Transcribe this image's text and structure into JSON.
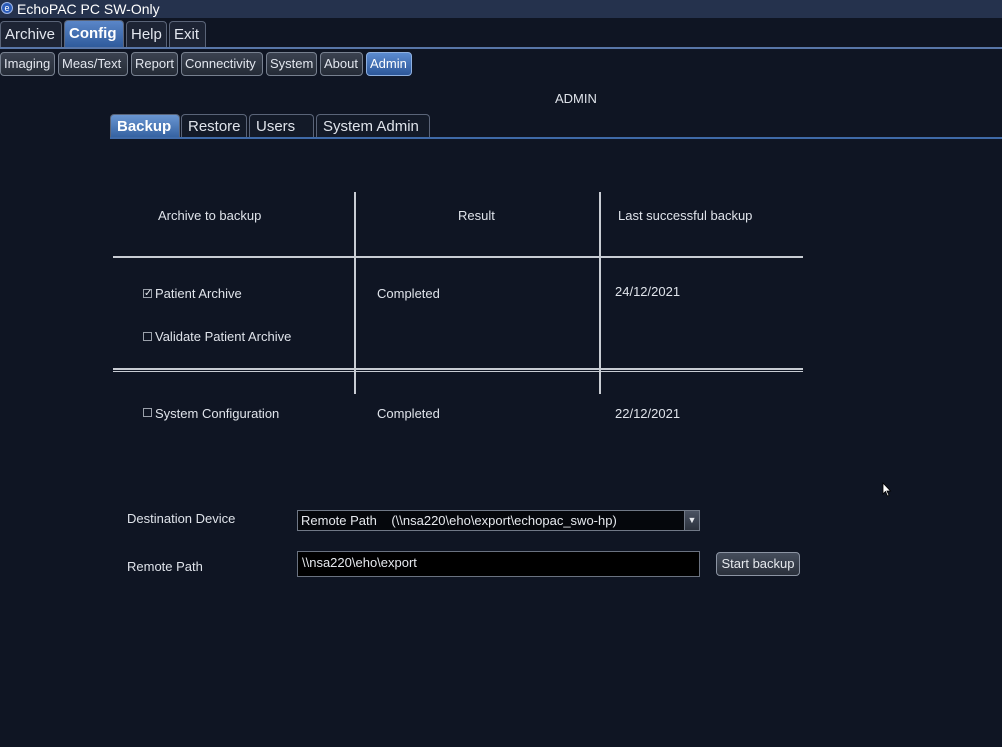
{
  "window": {
    "title": "EchoPAC PC SW-Only",
    "icon": "app-logo-icon"
  },
  "menu": {
    "tabs": [
      {
        "label": "Archive"
      },
      {
        "label": "Config",
        "active": true
      },
      {
        "label": "Help"
      },
      {
        "label": "Exit"
      }
    ]
  },
  "submenu": {
    "tabs": [
      {
        "label": "Imaging"
      },
      {
        "label": "Meas/Text"
      },
      {
        "label": "Report"
      },
      {
        "label": "Connectivity"
      },
      {
        "label": "System"
      },
      {
        "label": "About"
      },
      {
        "label": "Admin",
        "active": true
      }
    ]
  },
  "page": {
    "heading": "ADMIN"
  },
  "admin_tabs": [
    {
      "label": "Backup",
      "active": true
    },
    {
      "label": "Restore"
    },
    {
      "label": "Users"
    },
    {
      "label": "System Admin"
    }
  ],
  "table": {
    "headers": [
      "Archive to backup",
      "Result",
      "Last successful backup"
    ],
    "rows": [
      {
        "label": "Patient Archive",
        "checked": true,
        "result": "Completed",
        "last": "24/12/2021"
      },
      {
        "label": "Validate Patient Archive",
        "checked": false,
        "result": "",
        "last": ""
      },
      {
        "label": "System Configuration",
        "checked": false,
        "result": "Completed",
        "last": "22/12/2021"
      }
    ]
  },
  "form": {
    "destination_label": "Destination Device",
    "destination_value": "Remote Path    (\\\\nsa220\\eho\\export\\echopac_swo-hp)",
    "remote_path_label": "Remote Path",
    "remote_path_value": "\\\\nsa220\\eho\\export",
    "start_button": "Start backup"
  },
  "colors": {
    "background": "#0f1523",
    "accent": "#3f6aa8",
    "active_tab": "#4a78bb"
  }
}
